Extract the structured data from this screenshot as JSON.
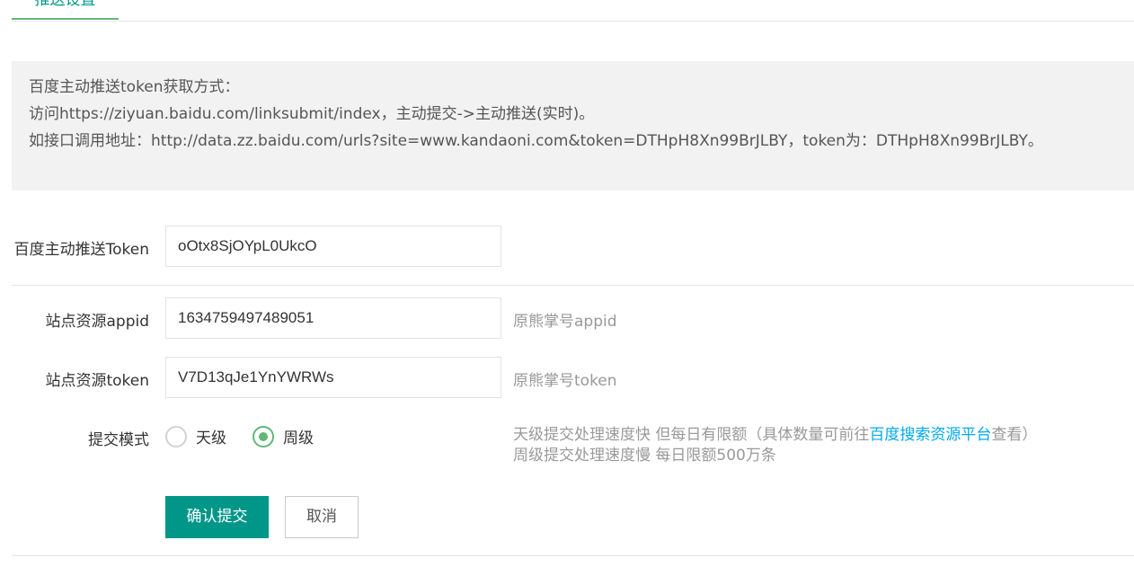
{
  "tab": {
    "label": "推送设置"
  },
  "notice": {
    "line1": "百度主动推送token获取方式：",
    "line2": "访问https://ziyuan.baidu.com/linksubmit/index，主动提交->主动推送(实时)。",
    "line3": "如接口调用地址：http://data.zz.baidu.com/urls?site=www.kandaoni.com&token=DTHpH8Xn99BrJLBY，token为：DTHpH8Xn99BrJLBY。"
  },
  "form": {
    "baidu_token": {
      "label": "百度主动推送Token",
      "value": "oOtx8SjOYpL0UkcO"
    },
    "appid": {
      "label": "站点资源appid",
      "value": "1634759497489051",
      "aux": "原熊掌号appid"
    },
    "site_token": {
      "label": "站点资源token",
      "value": "V7D13qJe1YnYWRWs",
      "aux": "原熊掌号token"
    },
    "mode": {
      "label": "提交模式",
      "options": [
        "天级",
        "周级"
      ],
      "selected": "周级",
      "hint_line1_prefix": "天级提交处理速度快 但每日有限额（具体数量可前往",
      "hint_link": "百度搜索资源平台",
      "hint_line1_suffix": "查看）",
      "hint_line2": "周级提交处理速度慢 每日限额500万条"
    }
  },
  "buttons": {
    "submit": "确认提交",
    "cancel": "取消"
  },
  "colors": {
    "primary": "#009688",
    "radio_checked": "#5FB878",
    "link": "#01AAED"
  }
}
